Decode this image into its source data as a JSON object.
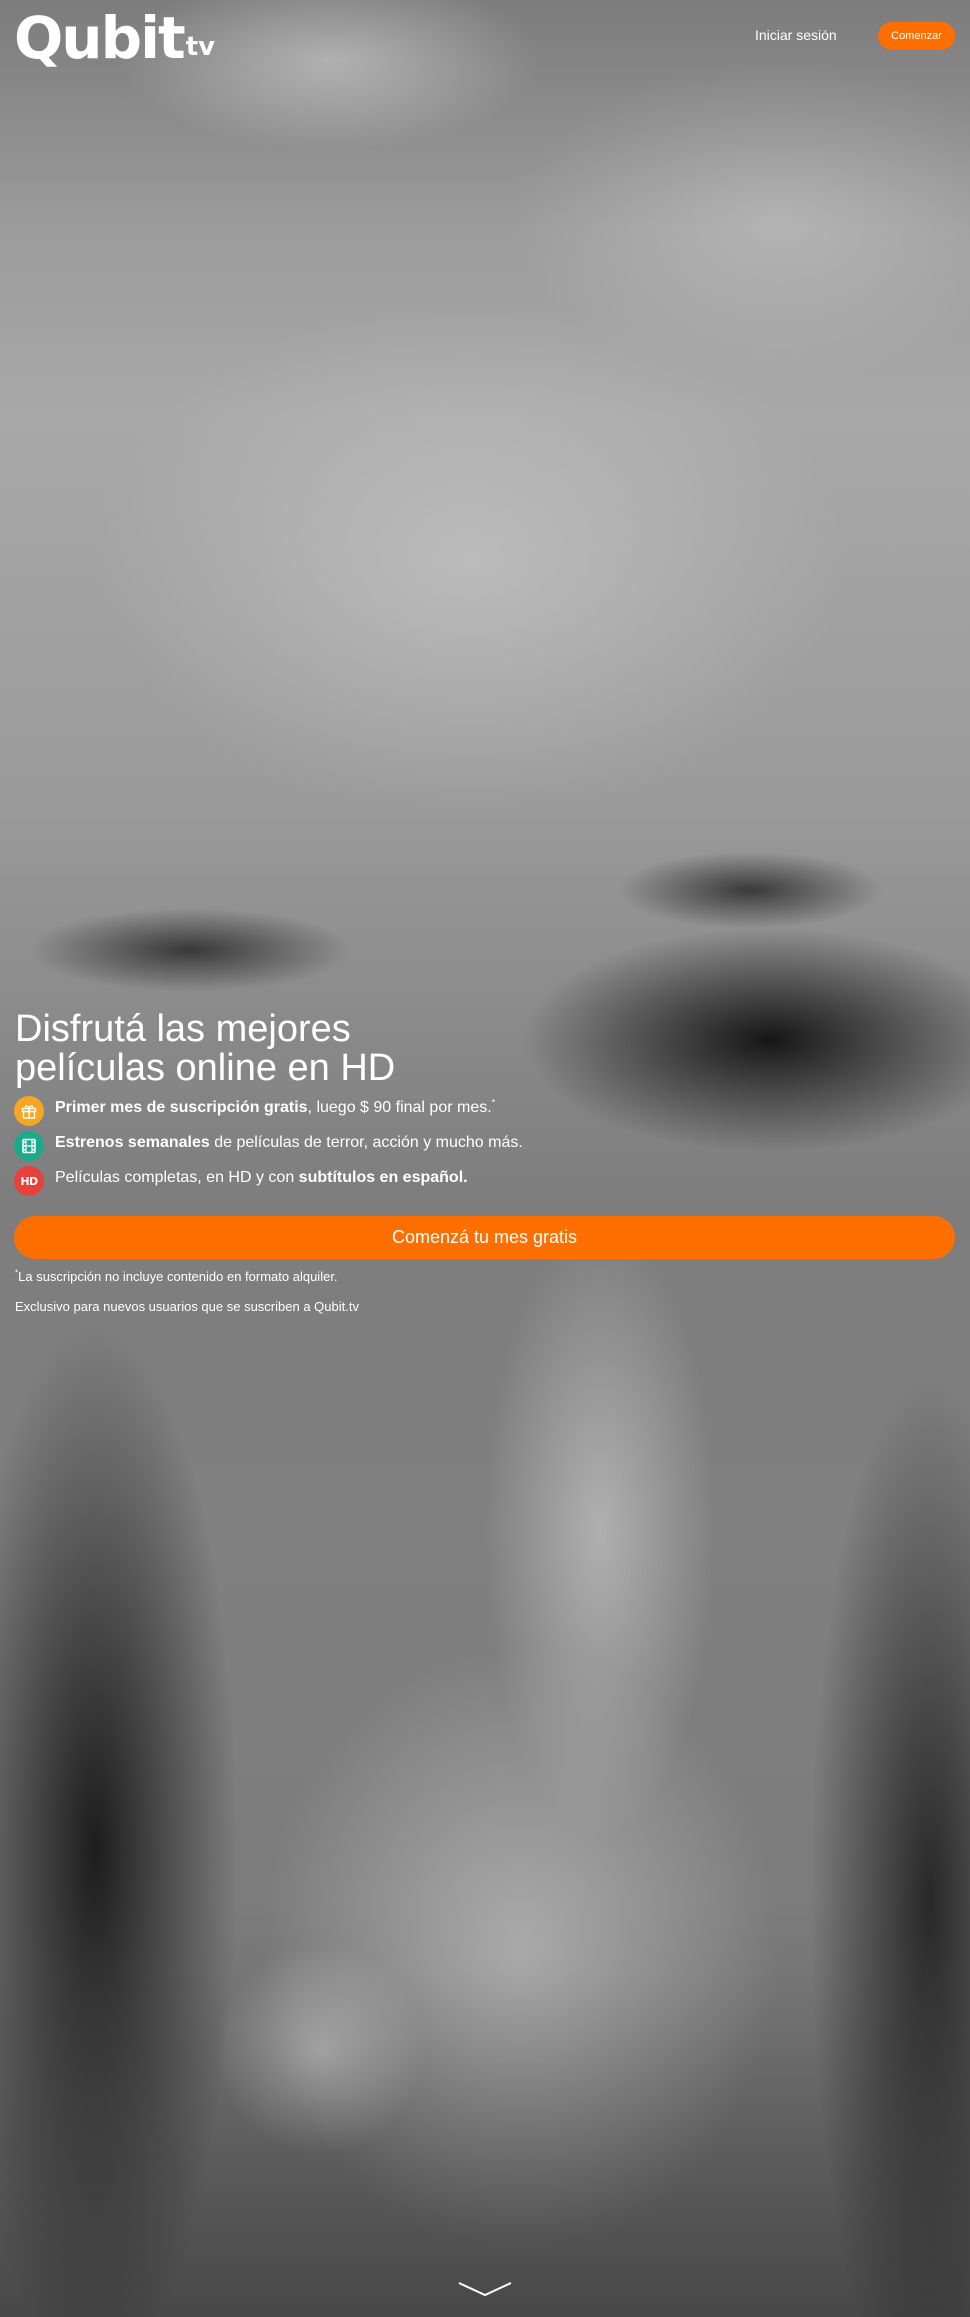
{
  "header": {
    "logo_text": "Qubit",
    "logo_suffix": "tv",
    "login_label": "Iniciar sesión",
    "cta_label": "Comenzar"
  },
  "hero": {
    "title_line1": "Disfrutá las mejores",
    "title_line2": "películas online en HD",
    "features": [
      {
        "icon": "gift-icon",
        "bold": "Primer mes de suscripción gratis",
        "rest": ", luego $ 90 final por mes.",
        "mark": "*"
      },
      {
        "icon": "film-icon",
        "bold": "Estrenos semanales",
        "rest": " de películas de terror, acción y mucho más."
      },
      {
        "icon": "hd-icon",
        "icon_text": "HD",
        "pre": "Películas completas, en HD y con ",
        "bold": "subtítulos en español."
      }
    ],
    "cta_label": "Comenzá tu mes gratis",
    "note_mark": "*",
    "note": "La suscripción no incluye contenido en formato alquiler.",
    "note2": "Exclusivo para nuevos usuarios que se suscriben a Qubit.tv"
  },
  "colors": {
    "accent": "#ff6f00",
    "gift_icon": "#f5a623",
    "film_icon": "#1aab8a",
    "hd_icon": "#e8403a"
  }
}
